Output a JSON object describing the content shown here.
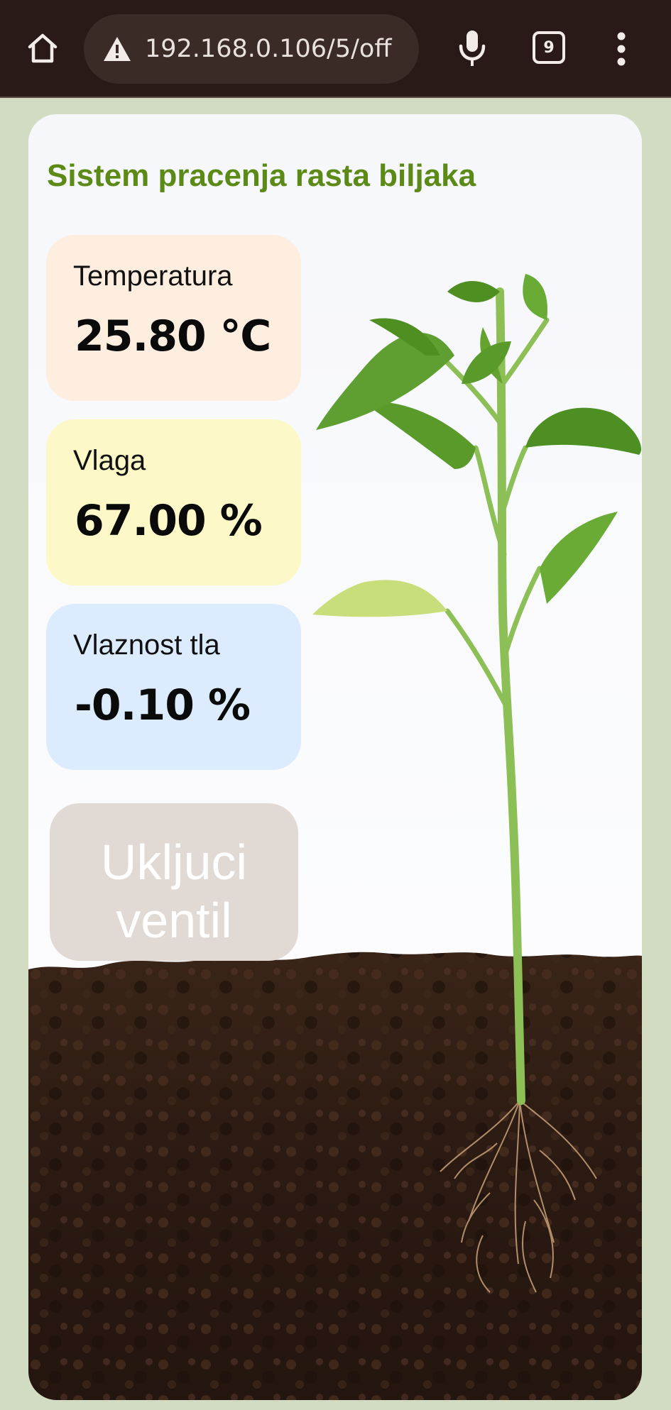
{
  "browser": {
    "url": "192.168.0.106/5/off",
    "tab_count": "9",
    "icons": {
      "home": "home-icon",
      "warning": "warning-triangle-icon",
      "mic": "microphone-icon",
      "menu": "more-vert-icon"
    }
  },
  "page": {
    "title": "Sistem pracenja rasta biljaka",
    "title_color": "#5b8a17",
    "metrics": [
      {
        "label": "Temperatura",
        "value": "25.80 ℃",
        "bg": "#fdeee0"
      },
      {
        "label": "Vlaga",
        "value": "67.00 %",
        "bg": "#fdf8c8"
      },
      {
        "label": "Vlaznost tla",
        "value": "-0.10 %",
        "bg": "#dcecfe"
      }
    ],
    "valve_button": "Ukljuci ventil"
  }
}
